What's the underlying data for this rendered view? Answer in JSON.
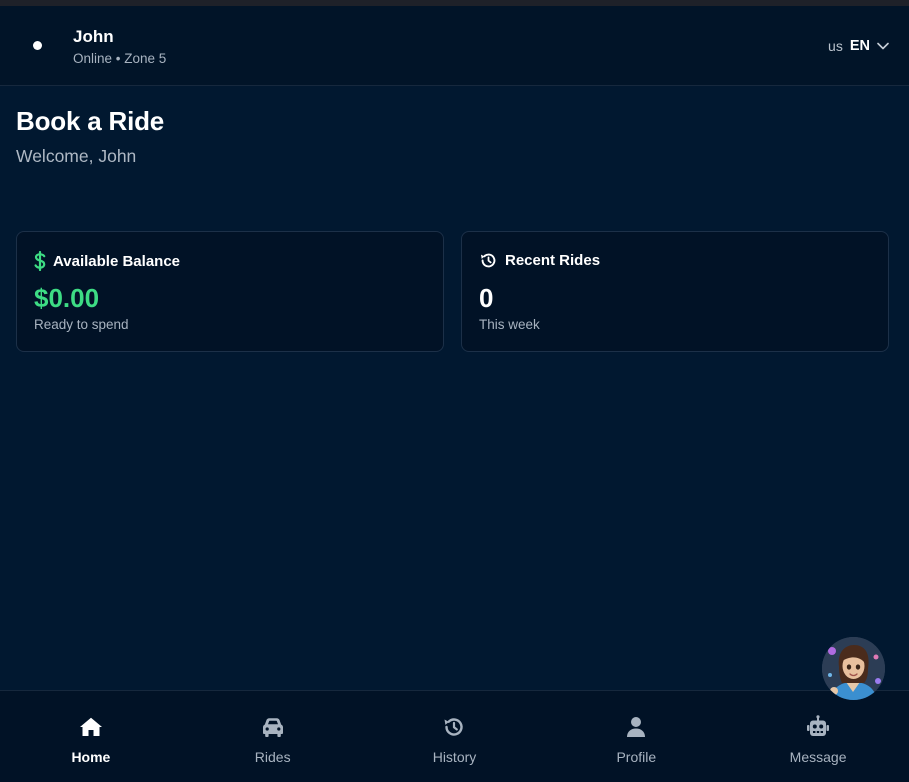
{
  "header": {
    "user_name": "John",
    "user_status": "Online • Zone 5",
    "language": {
      "flag": "us",
      "code": "EN"
    }
  },
  "main": {
    "title": "Book a Ride",
    "welcome": "Welcome, John",
    "cards": [
      {
        "label": "Available Balance",
        "value": "$0.00",
        "sub": "Ready to spend",
        "icon": "dollar-icon",
        "value_color": "#3ddc84"
      },
      {
        "label": "Recent Rides",
        "value": "0",
        "sub": "This week",
        "icon": "history-icon"
      }
    ]
  },
  "bottom_nav": {
    "items": [
      {
        "label": "Home",
        "icon": "home-icon",
        "active": true
      },
      {
        "label": "Rides",
        "icon": "car-icon"
      },
      {
        "label": "History",
        "icon": "history-icon"
      },
      {
        "label": "Profile",
        "icon": "user-icon"
      },
      {
        "label": "Message",
        "icon": "robot-icon"
      }
    ]
  },
  "colors": {
    "background": "#011830",
    "header": "#011428",
    "accent_green": "#3ddc84",
    "muted_text": "#a8b3c0"
  }
}
